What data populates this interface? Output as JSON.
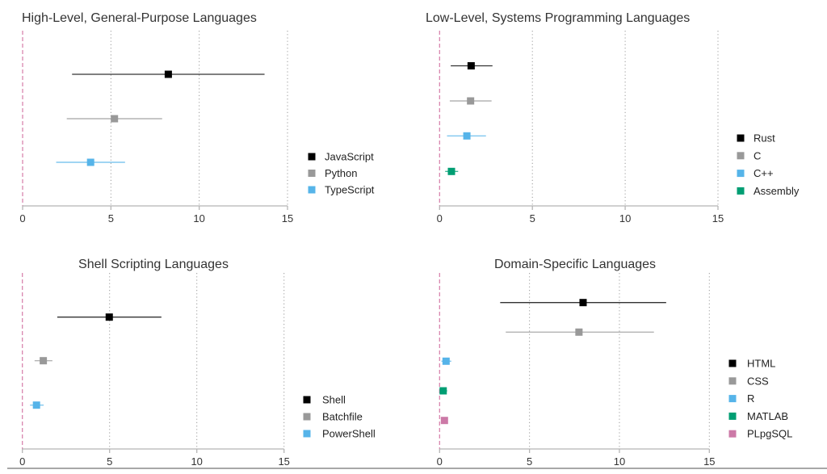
{
  "chart_data": [
    {
      "type": "forest",
      "title": "High-Level, General-Purpose Languages",
      "xlabel": "",
      "ylabel": "",
      "xlim": [
        0,
        15
      ],
      "xticks": [
        0,
        5,
        10,
        15
      ],
      "xtick_labels": [
        "0",
        "5",
        "10",
        "15"
      ],
      "grid": "vertical dotted at 5, 10, 15",
      "reference_line": 0,
      "legend_position": "right",
      "series": [
        {
          "name": "JavaScript",
          "color": "#000000",
          "estimate": 8.25,
          "low": 2.8,
          "high": 13.7
        },
        {
          "name": "Python",
          "color": "#999999",
          "estimate": 5.2,
          "low": 2.5,
          "high": 7.9
        },
        {
          "name": "TypeScript",
          "color": "#56B4E9",
          "estimate": 3.85,
          "low": 1.9,
          "high": 5.8
        }
      ]
    },
    {
      "type": "forest",
      "title": "Low-Level, Systems Programming Languages",
      "xlabel": "",
      "ylabel": "",
      "xlim": [
        0,
        15
      ],
      "xticks": [
        0,
        5,
        10,
        15
      ],
      "xtick_labels": [
        "0",
        "5",
        "10",
        "15"
      ],
      "grid": "vertical dotted at 5, 10, 15",
      "reference_line": 0,
      "legend_position": "right",
      "series": [
        {
          "name": "Rust",
          "color": "#000000",
          "estimate": 1.7,
          "low": 0.6,
          "high": 2.85
        },
        {
          "name": "C",
          "color": "#999999",
          "estimate": 1.67,
          "low": 0.55,
          "high": 2.8
        },
        {
          "name": "C++",
          "color": "#56B4E9",
          "estimate": 1.47,
          "low": 0.4,
          "high": 2.5
        },
        {
          "name": "Assembly",
          "color": "#009E73",
          "estimate": 0.64,
          "low": 0.3,
          "high": 1.0
        }
      ]
    },
    {
      "type": "forest",
      "title": "Shell Scripting Languages",
      "xlabel": "",
      "ylabel": "",
      "xlim": [
        0,
        15
      ],
      "xticks": [
        0,
        5,
        10,
        15
      ],
      "xtick_labels": [
        "0",
        "5",
        "10",
        "15"
      ],
      "grid": "vertical dotted at 5, 10, 15",
      "reference_line": 0,
      "legend_position": "right",
      "series": [
        {
          "name": "Shell",
          "color": "#000000",
          "estimate": 4.98,
          "low": 2.0,
          "high": 7.97
        },
        {
          "name": "Batchfile",
          "color": "#999999",
          "estimate": 1.2,
          "low": 0.7,
          "high": 1.72
        },
        {
          "name": "PowerShell",
          "color": "#56B4E9",
          "estimate": 0.81,
          "low": 0.44,
          "high": 1.22
        }
      ]
    },
    {
      "type": "forest",
      "title": "Domain-Specific Languages",
      "xlabel": "",
      "ylabel": "",
      "xlim": [
        0,
        15
      ],
      "xticks": [
        0,
        5,
        10,
        15
      ],
      "xtick_labels": [
        "0",
        "5",
        "10",
        "15"
      ],
      "grid": "vertical dotted at 5, 10, 15",
      "reference_line": 0,
      "legend_position": "right",
      "series": [
        {
          "name": "HTML",
          "color": "#000000",
          "estimate": 7.98,
          "low": 3.37,
          "high": 12.6
        },
        {
          "name": "CSS",
          "color": "#999999",
          "estimate": 7.75,
          "low": 3.68,
          "high": 11.92
        },
        {
          "name": "R",
          "color": "#56B4E9",
          "estimate": 0.36,
          "low": 0.1,
          "high": 0.65
        },
        {
          "name": "MATLAB",
          "color": "#009E73",
          "estimate": 0.2,
          "low": 0.05,
          "high": 0.42
        },
        {
          "name": "PLpgSQL",
          "color": "#CC79A7",
          "estimate": 0.27,
          "low": 0.15,
          "high": 0.4
        }
      ]
    }
  ],
  "colors": {
    "reference_line": "#D67BA8",
    "grid": "#9a9a9a",
    "axis": "#b5b5b5",
    "text": "#333333",
    "bottom_rule": "#a8a8a8"
  }
}
